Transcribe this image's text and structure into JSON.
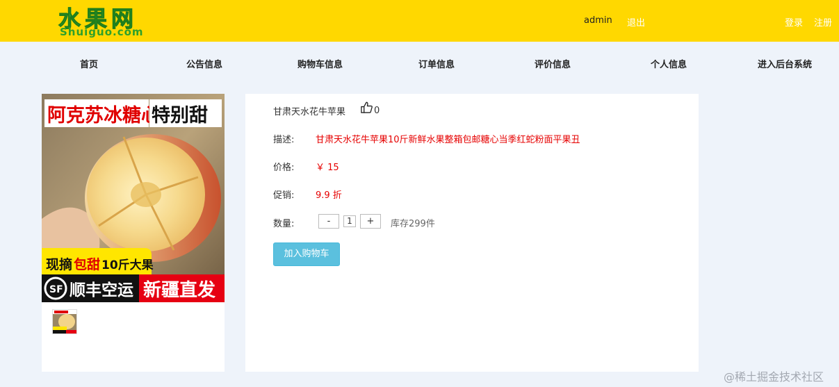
{
  "header": {
    "logo_cn": "水果网",
    "logo_en": "Shuiguo.com",
    "username": "admin",
    "logout_label": "退出",
    "login_label": "登录",
    "register_label": "注册"
  },
  "nav": {
    "items": [
      {
        "label": "首页"
      },
      {
        "label": "公告信息"
      },
      {
        "label": "购物车信息"
      },
      {
        "label": "订单信息"
      },
      {
        "label": "评价信息"
      },
      {
        "label": "个人信息"
      },
      {
        "label": "进入后台系统"
      }
    ]
  },
  "product_image": {
    "banner_top": "阿克苏冰糖心",
    "banner_top_right": "特别甜",
    "banner_mid_left": "现摘",
    "banner_mid_red": "包甜",
    "banner_mid_right": "10斤大果",
    "banner_bottom_left": "顺丰空运",
    "banner_bottom_right": "新疆直发",
    "sf_logo_text": "SF"
  },
  "product": {
    "name": "甘肃天水花牛苹果",
    "like_count": "0",
    "desc_label": "描述:",
    "desc_value": "甘肃天水花牛苹果10斤新鲜水果整箱包邮糖心当季红蛇粉面平果丑",
    "price_label": "价格:",
    "price_value": "￥ 15",
    "promo_label": "促销:",
    "promo_value": "9.9 折",
    "qty_label": "数量:",
    "minus_label": "-",
    "qty_value": "1",
    "plus_label": "+",
    "stock_text": "库存299件",
    "add_cart_label": "加入购物车"
  },
  "watermark": "@稀土掘金技术社区",
  "colors": {
    "header_bg": "#ffd800",
    "page_bg": "#eef3fa",
    "accent_red": "#e60000",
    "button_blue": "#5bc0de",
    "logo_green": "#2ea02a"
  }
}
